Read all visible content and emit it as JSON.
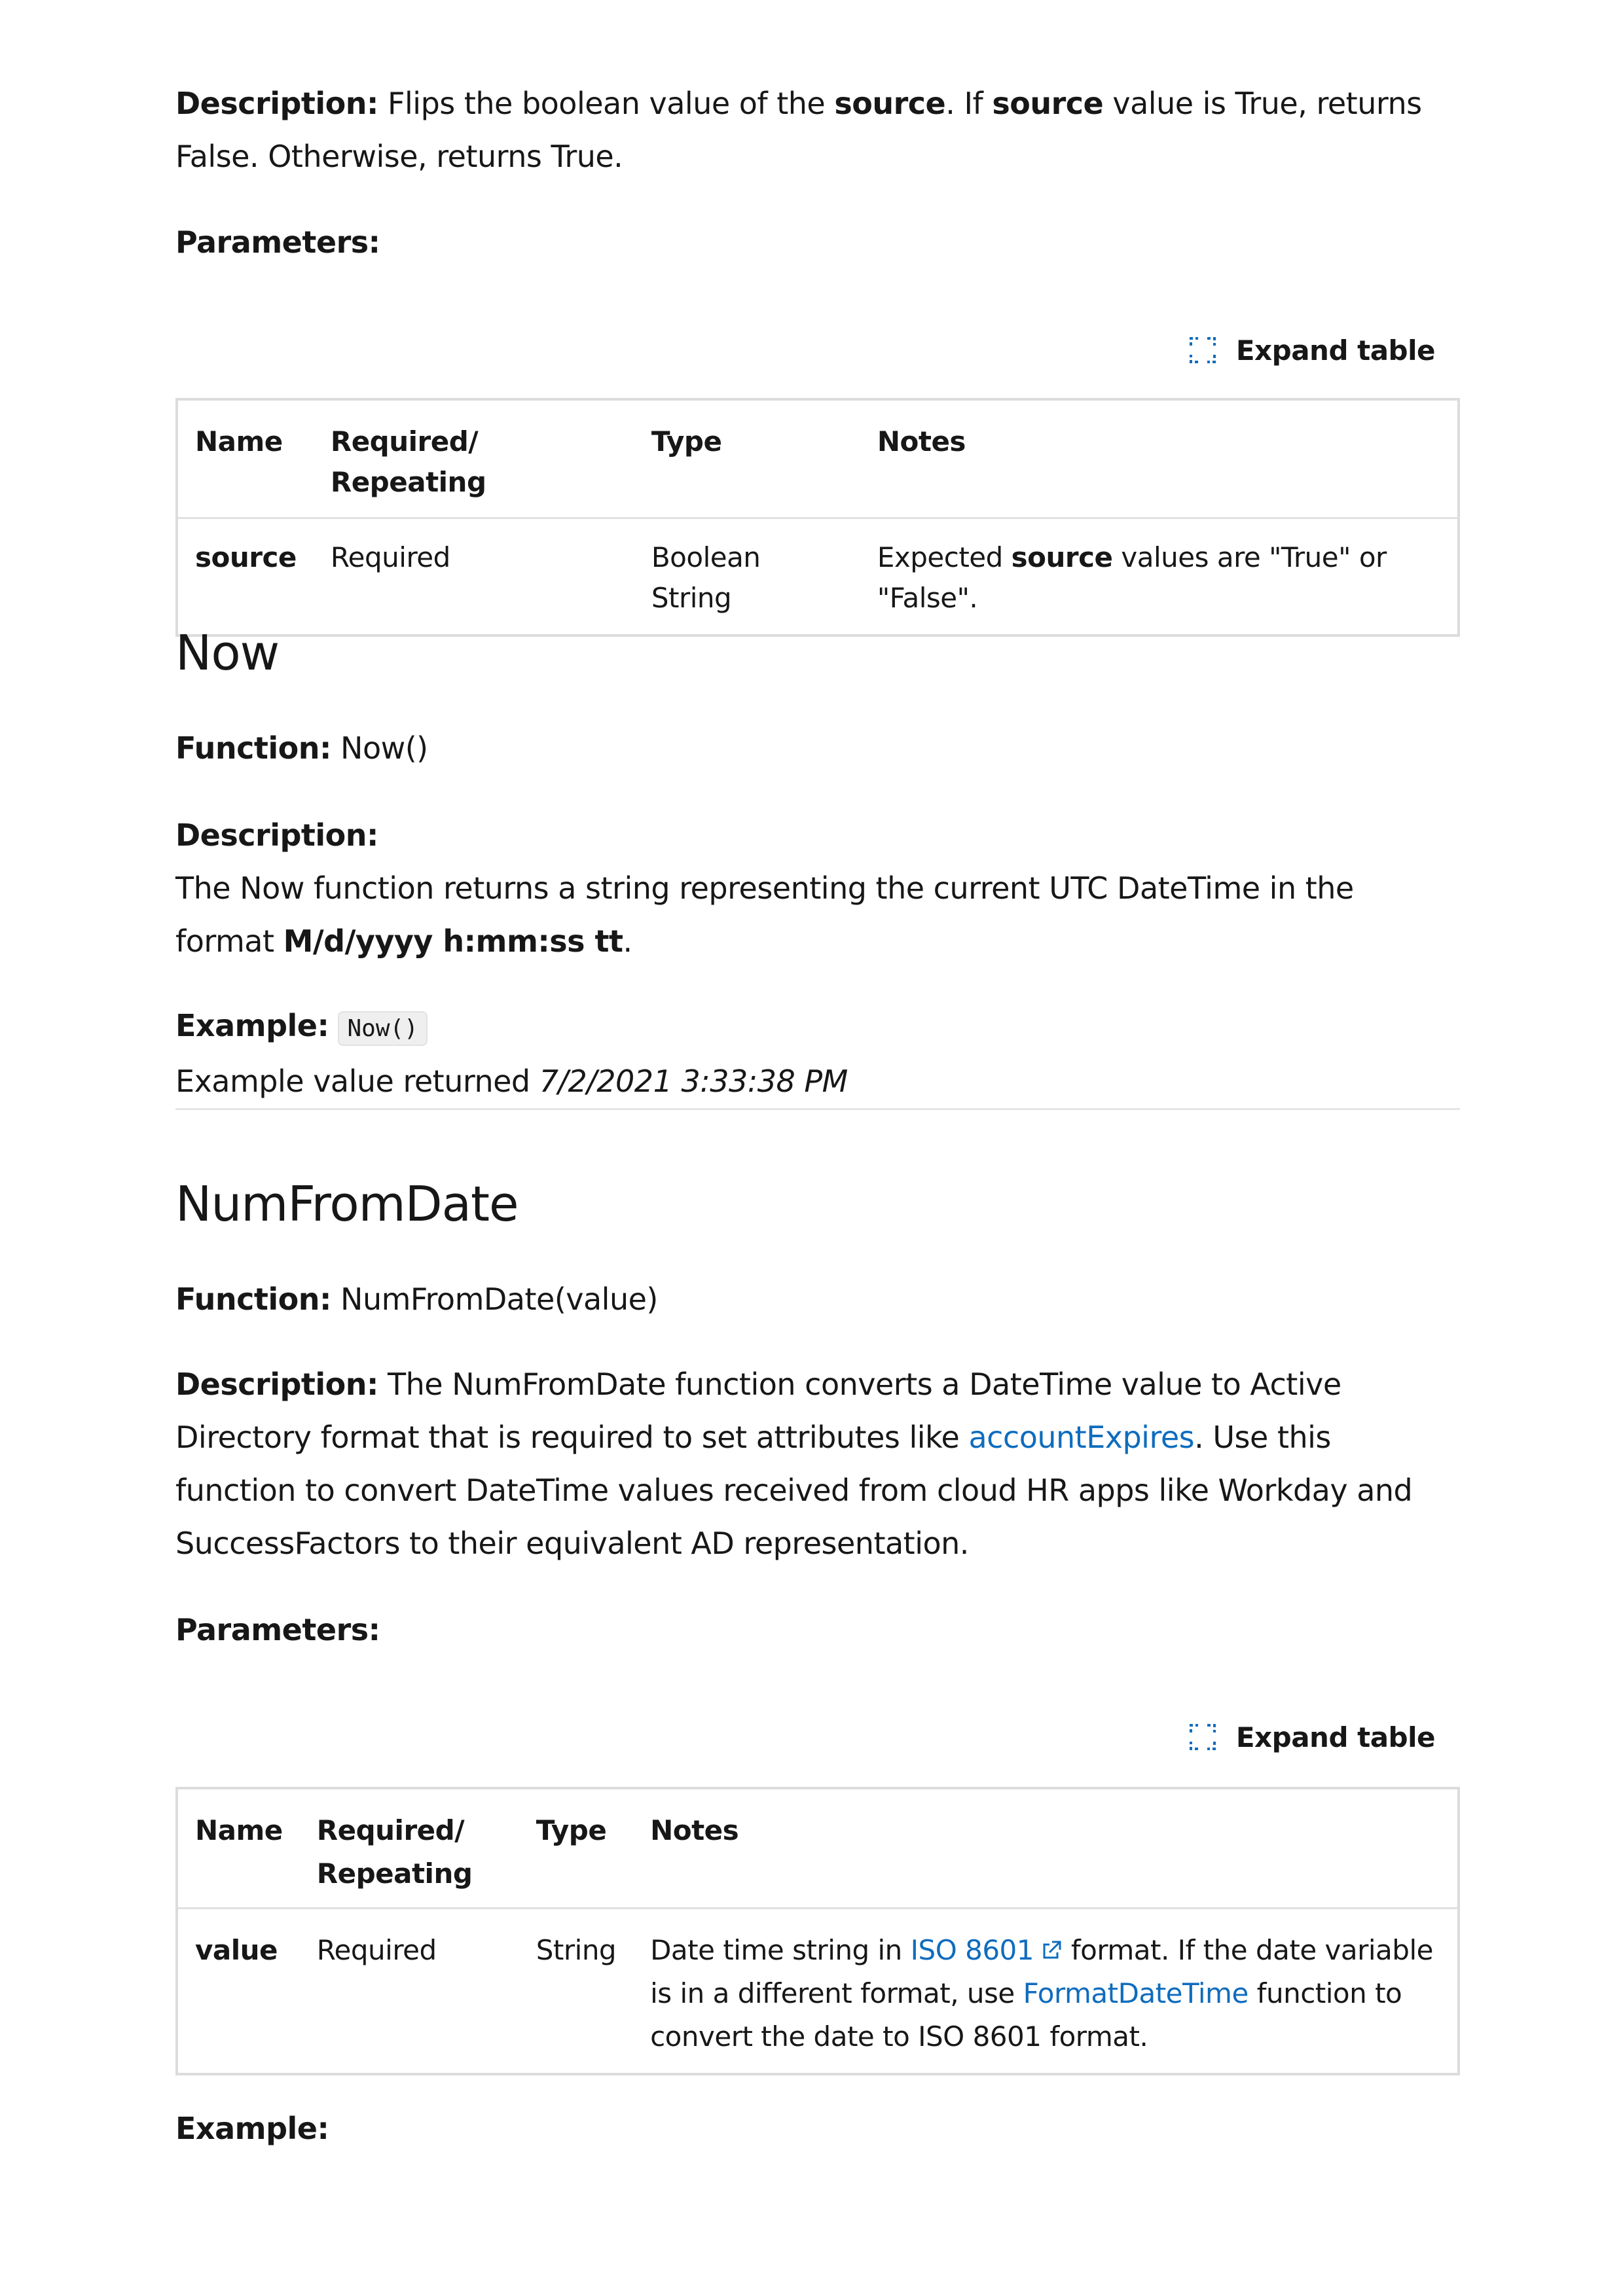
{
  "not_section": {
    "description_label": "Description:",
    "desc_part1": "Flips the boolean value of the",
    "desc_source1": "source",
    "desc_part2": ". If",
    "desc_source2": "source",
    "desc_part3": "value is True, returns False. Otherwise, returns True.",
    "parameters_label": "Parameters:",
    "expand_label": "Expand table",
    "table": {
      "headers": [
        "Name",
        "Required/ Repeating",
        "Type",
        "Notes"
      ],
      "row": {
        "name": "source",
        "required": "Required",
        "type": "Boolean String",
        "notes_pre": "Expected",
        "notes_bold": "source",
        "notes_post": "values are \"True\" or \"False\"."
      }
    }
  },
  "now_section": {
    "heading": "Now",
    "function_label": "Function:",
    "function_value": "Now()",
    "description_label": "Description:",
    "desc_text": "The Now function returns a string representing the current UTC DateTime in the format",
    "desc_format": "M/d/yyyy h:mm:ss tt",
    "desc_period": ".",
    "example_label": "Example:",
    "example_code": "Now()",
    "example_value_text": "Example value returned",
    "example_value": "7/2/2021 3:33:38 PM"
  },
  "numfromdate_section": {
    "heading": "NumFromDate",
    "function_label": "Function:",
    "function_value": "NumFromDate(value)",
    "description_label": "Description:",
    "desc_part1": "The NumFromDate function converts a DateTime value to Active Directory format that is required to set attributes like",
    "desc_link": "accountExpires",
    "desc_part2": ". Use this function to convert DateTime values received from cloud HR apps like Workday and SuccessFactors to their equivalent AD representation.",
    "parameters_label": "Parameters:",
    "expand_label": "Expand table",
    "table": {
      "headers": [
        "Name",
        "Required/ Repeating",
        "Type",
        "Notes"
      ],
      "row": {
        "name": "value",
        "required": "Required",
        "type": "String",
        "notes_pre": "Date time string in",
        "notes_link1": "ISO 8601",
        "notes_mid": "format. If the date variable is in a different format, use",
        "notes_link2": "FormatDateTime",
        "notes_post": "function to convert the date to ISO 8601 format."
      }
    },
    "example_label": "Example:"
  },
  "colors": {
    "link": "#0f6cbd",
    "text": "#171717",
    "border": "#dcdcdc",
    "code_bg": "#efefef"
  },
  "icons": [
    "expand-icon",
    "external-link-icon"
  ]
}
